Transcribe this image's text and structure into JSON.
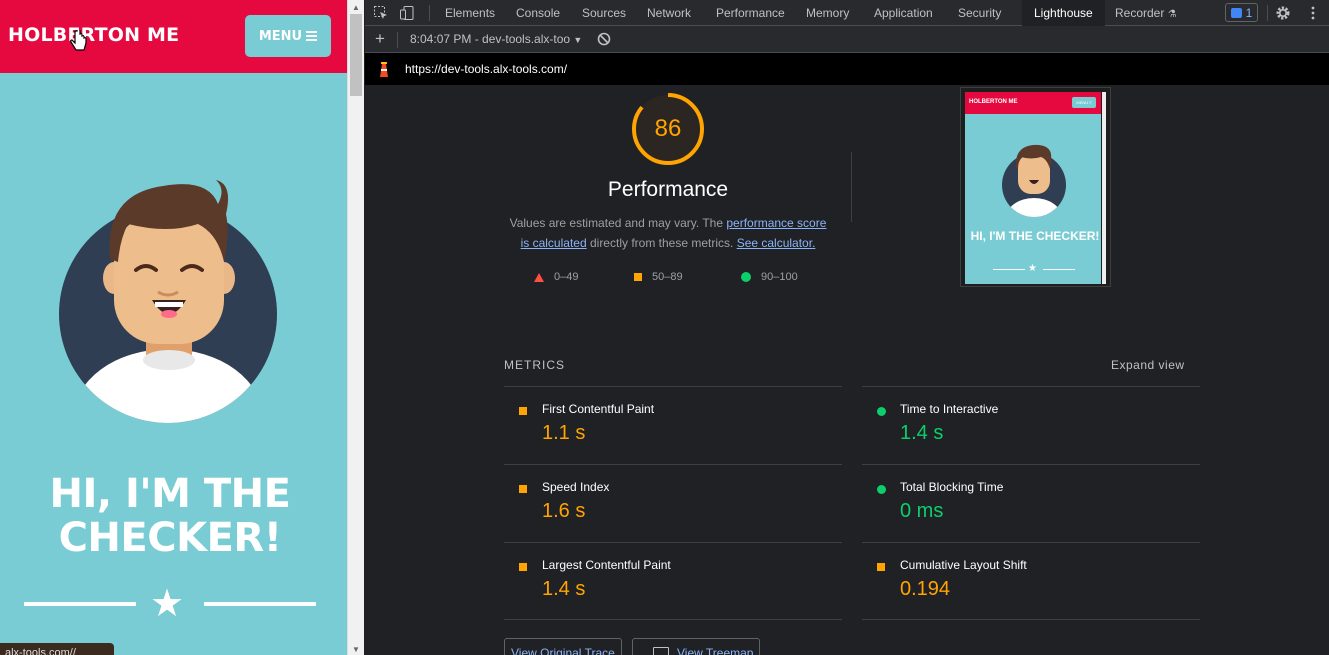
{
  "page": {
    "logo": "HOLBERTON ME",
    "menu_label": "MENU",
    "hero_title": "HI, I'M THE CHECKER!",
    "status_url": "alx-tools.com//"
  },
  "devtools": {
    "tabs": [
      "Elements",
      "Console",
      "Sources",
      "Network",
      "Performance",
      "Memory",
      "Application",
      "Security",
      "Lighthouse",
      "Recorder"
    ],
    "active_tab": "Lighthouse",
    "issues_count": "1",
    "report_selector": "8:04:07 PM - dev-tools.alx-too",
    "url": "https://dev-tools.alx-tools.com/"
  },
  "lighthouse": {
    "score": "86",
    "category": "Performance",
    "desc_prefix": "Values are estimated and may vary. The ",
    "desc_link1": "performance score is calculated",
    "desc_middle": " directly from these metrics. ",
    "desc_link2": "See calculator.",
    "legend": {
      "fail": "0–49",
      "average": "50–89",
      "pass": "90–100"
    },
    "thumbnail": {
      "logo": "HOLBERTON ME",
      "menu": "MENU ≡",
      "title": "HI, I'M THE CHECKER!"
    },
    "metrics_label": "METRICS",
    "expand_view": "Expand view",
    "metrics": {
      "fcp": {
        "name": "First Contentful Paint",
        "value": "1.1 s",
        "status": "average"
      },
      "tti": {
        "name": "Time to Interactive",
        "value": "1.4 s",
        "status": "pass"
      },
      "si": {
        "name": "Speed Index",
        "value": "1.6 s",
        "status": "average"
      },
      "tbt": {
        "name": "Total Blocking Time",
        "value": "0 ms",
        "status": "pass"
      },
      "lcp": {
        "name": "Largest Contentful Paint",
        "value": "1.4 s",
        "status": "average"
      },
      "cls": {
        "name": "Cumulative Layout Shift",
        "value": "0.194",
        "status": "average"
      }
    },
    "buttons": {
      "view_trace": "View Original Trace",
      "view_treemap": "View Treemap"
    }
  },
  "colors": {
    "brand_red": "#e5093f",
    "brand_teal": "#79ccd4",
    "average": "#ffa400",
    "pass": "#0cce6b",
    "fail": "#ff4e42"
  }
}
